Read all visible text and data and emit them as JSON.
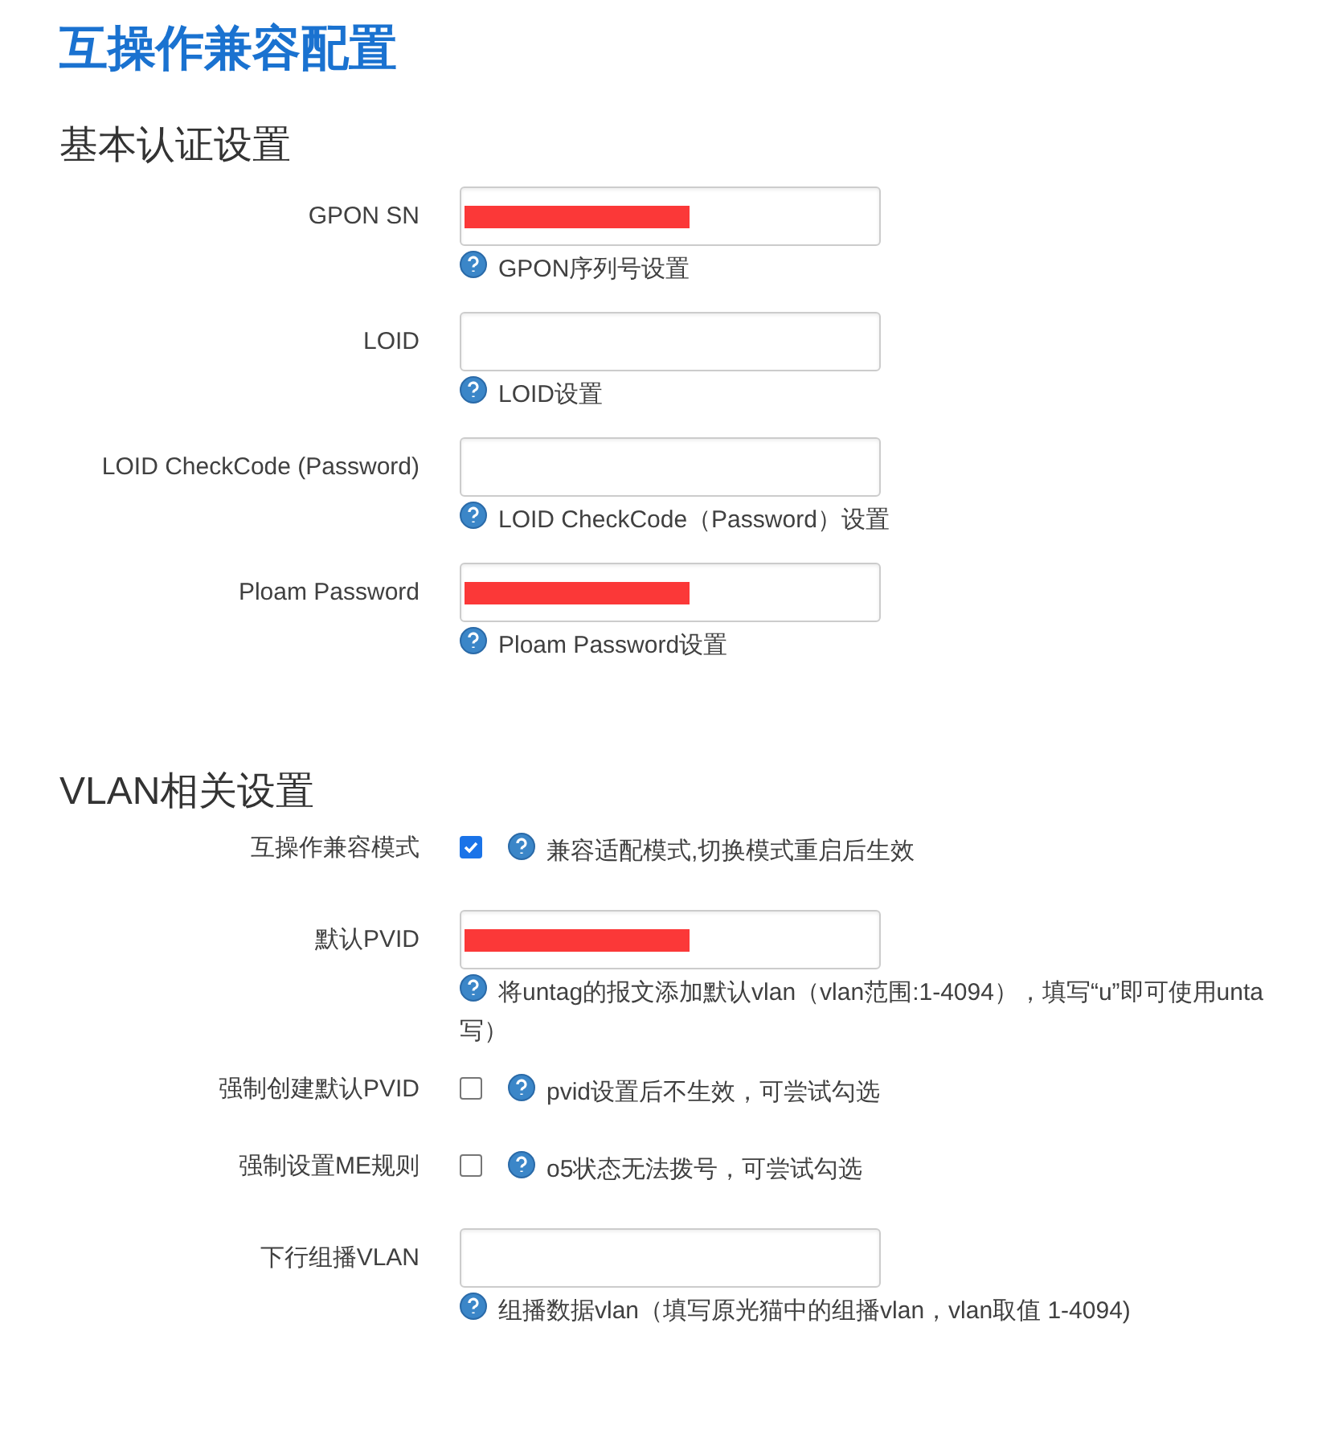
{
  "title": "互操作兼容配置",
  "sections": [
    {
      "title": "基本认证设置",
      "fields": [
        {
          "kind": "text",
          "label": "GPON SN",
          "redacted": true,
          "hint": [
            "GPON序列号设置"
          ]
        },
        {
          "kind": "text",
          "label": "LOID",
          "redacted": false,
          "hint": [
            "LOID设置"
          ]
        },
        {
          "kind": "text",
          "label": "LOID CheckCode (Password)",
          "redacted": false,
          "hint": [
            "LOID CheckCode（Password）设置"
          ]
        },
        {
          "kind": "text",
          "label": "Ploam Password",
          "redacted": true,
          "hint": [
            "Ploam Password设置"
          ]
        }
      ]
    },
    {
      "title": "VLAN相关设置",
      "fields": [
        {
          "kind": "checkbox",
          "label": "互操作兼容模式",
          "checked": true,
          "hint": [
            "兼容适配模式,切换模式重启后生效"
          ]
        },
        {
          "kind": "text",
          "label": "默认PVID",
          "redacted": true,
          "hint": [
            "将untag的报文添加默认vlan（vlan范围:1-4094），填写“u”即可使用unta",
            "写）"
          ]
        },
        {
          "kind": "checkbox",
          "label": "强制创建默认PVID",
          "checked": false,
          "hint": [
            "pvid设置后不生效，可尝试勾选"
          ]
        },
        {
          "kind": "checkbox",
          "label": "强制设置ME规则",
          "checked": false,
          "hint": [
            "o5状态无法拨号，可尝试勾选"
          ]
        },
        {
          "kind": "text",
          "label": "下行组播VLAN",
          "redacted": false,
          "hint": [
            "组播数据vlan（填写原光猫中的组播vlan，vlan取值 1-4094)"
          ]
        }
      ]
    }
  ]
}
